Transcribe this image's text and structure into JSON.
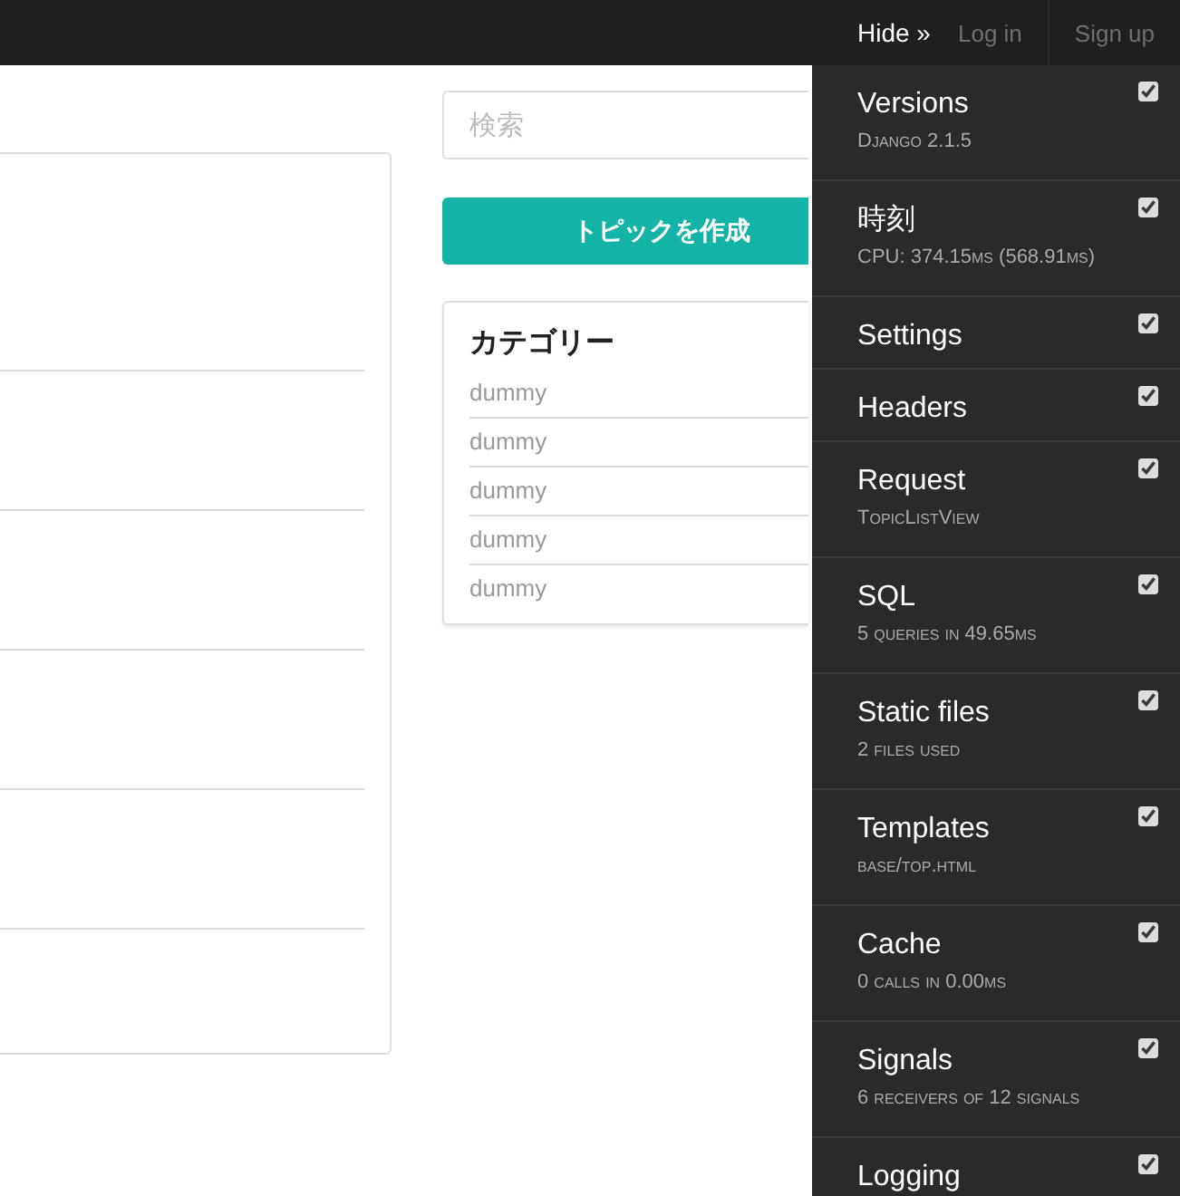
{
  "navbar": {
    "links": [
      {
        "label": "Log in"
      },
      {
        "label": "Sign up"
      }
    ]
  },
  "search": {
    "placeholder": "検索"
  },
  "create_button": "トピックを作成",
  "categories": {
    "title": "カテゴリー",
    "items": [
      "dummy",
      "dummy",
      "dummy",
      "dummy",
      "dummy"
    ]
  },
  "toolbar": {
    "hide": "Hide »",
    "panels": [
      {
        "title": "Versions",
        "subtitle": "Django 2.1.5",
        "checked": true
      },
      {
        "title": "時刻",
        "subtitle": "CPU: 374.15ms (568.91ms)",
        "checked": true
      },
      {
        "title": "Settings",
        "checked": true
      },
      {
        "title": "Headers",
        "checked": true
      },
      {
        "title": "Request",
        "subtitle": "TopicListView",
        "checked": true
      },
      {
        "title": "SQL",
        "subtitle": "5 queries in 49.65ms",
        "checked": true
      },
      {
        "title": "Static files",
        "subtitle": "2 files used",
        "checked": true
      },
      {
        "title": "Templates",
        "subtitle": "base/top.html",
        "checked": true
      },
      {
        "title": "Cache",
        "subtitle": "0 calls in 0.00ms",
        "checked": true
      },
      {
        "title": "Signals",
        "subtitle": "6 receivers of 12 signals",
        "checked": true
      },
      {
        "title": "Logging",
        "checked": true
      }
    ]
  }
}
